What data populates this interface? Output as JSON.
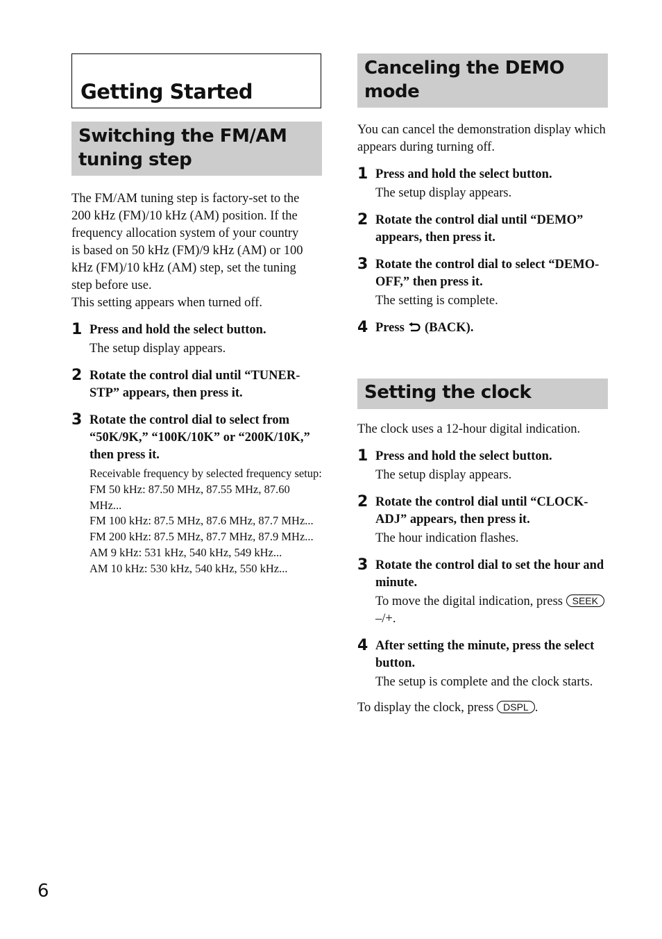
{
  "chapter": {
    "title": "Getting Started"
  },
  "left": {
    "section_title": "Switching the FM/AM tuning step",
    "intro_lines": [
      "The FM/AM tuning step is factory-set to the",
      "200 kHz (FM)/10 kHz (AM) position. If the",
      "frequency allocation system of your country",
      "is based on 50 kHz (FM)/9 kHz (AM) or 100",
      "kHz (FM)/10 kHz (AM) step, set the tuning",
      "step before use."
    ],
    "intro_note": "This setting appears when turned off.",
    "steps": [
      {
        "num": "1",
        "title": "Press and hold the select button.",
        "body": "The setup display appears."
      },
      {
        "num": "2",
        "title": "Rotate the control dial until “TUNER-STP” appears, then press it.",
        "body": ""
      },
      {
        "num": "3",
        "title": "Rotate the control dial to select from “50K/9K,” “100K/10K” or “200K/10K,” then press it.",
        "body": ""
      }
    ],
    "freq_note": {
      "heading": "Receivable frequency by selected frequency setup:",
      "lines": [
        "FM 50 kHz: 87.50 MHz, 87.55 MHz, 87.60 MHz...",
        "FM 100 kHz: 87.5 MHz, 87.6 MHz, 87.7 MHz...",
        "FM 200 kHz: 87.5 MHz, 87.7 MHz, 87.9 MHz...",
        "AM 9 kHz: 531 kHz, 540 kHz, 549 kHz...",
        "AM 10 kHz: 530 kHz, 540 kHz, 550 kHz..."
      ]
    }
  },
  "demo": {
    "section_title": "Canceling the DEMO mode",
    "intro": "You can cancel the demonstration display which appears during turning off.",
    "steps": [
      {
        "num": "1",
        "title": "Press and hold the select button.",
        "body": "The setup display appears."
      },
      {
        "num": "2",
        "title": "Rotate the control dial until “DEMO” appears, then press it.",
        "body": ""
      },
      {
        "num": "3",
        "title": "Rotate the control dial to select “DEMO-OFF,” then press it.",
        "body": "The setting is complete."
      },
      {
        "num": "4",
        "title_prefix": "Press",
        "icon": "back-arrow-icon",
        "title_suffix": "(BACK).",
        "body": ""
      }
    ]
  },
  "clock": {
    "section_title": "Setting the clock",
    "intro": "The clock uses a 12-hour digital indication.",
    "steps": [
      {
        "num": "1",
        "title": "Press and hold the select button.",
        "body": "The setup display appears."
      },
      {
        "num": "2",
        "title": "Rotate the control dial until “CLOCK-ADJ” appears, then press it.",
        "body": "The hour indication flashes."
      },
      {
        "num": "3",
        "title": "Rotate the control dial to set the hour and minute.",
        "body_prefix": "To move the digital indication, press",
        "key": "SEEK",
        "body_suffix": "–/+."
      },
      {
        "num": "4",
        "title": "After setting the minute, press the select button.",
        "body": "The setup is complete and the clock starts."
      }
    ],
    "outro_prefix": "To display the clock, press",
    "outro_key": "DSPL",
    "outro_suffix": "."
  },
  "page_number": "6"
}
